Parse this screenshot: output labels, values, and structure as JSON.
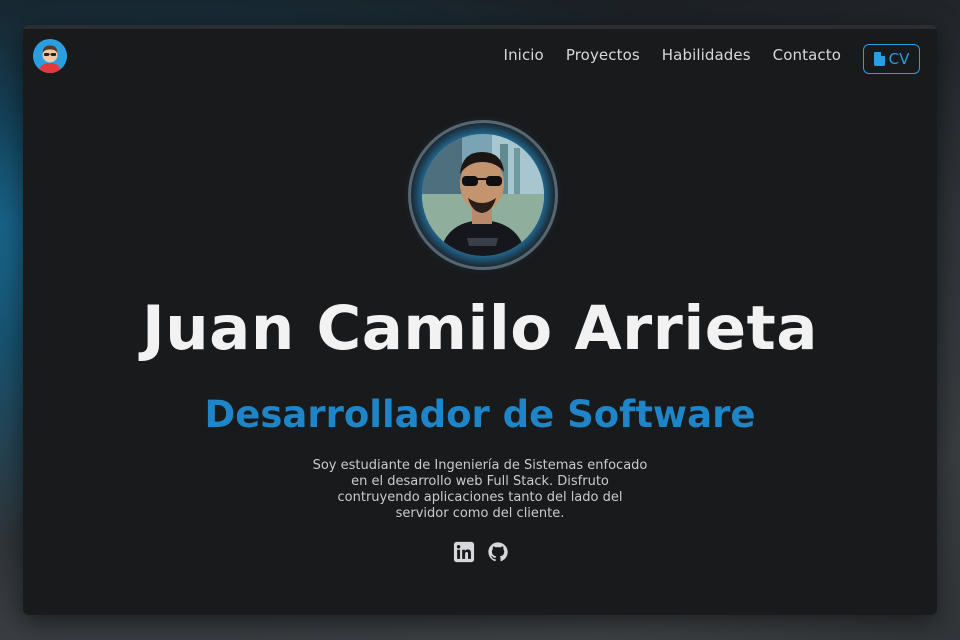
{
  "nav": {
    "links": [
      "Inicio",
      "Proyectos",
      "Habilidades",
      "Contacto"
    ],
    "cv_label": "CV"
  },
  "hero": {
    "name": "Juan Camilo Arrieta",
    "role": "Desarrollador de Software",
    "bio": "Soy estudiante de Ingeniería de Sistemas enfocado en el desarrollo web Full Stack. Disfruto contruyendo aplicaciones tanto del lado del servidor como del cliente."
  },
  "socials": [
    "linkedin-icon",
    "github-icon"
  ],
  "colors": {
    "accent": "#1e86c8",
    "window_bg": "#191a1c",
    "text": "#f2f2f2"
  }
}
